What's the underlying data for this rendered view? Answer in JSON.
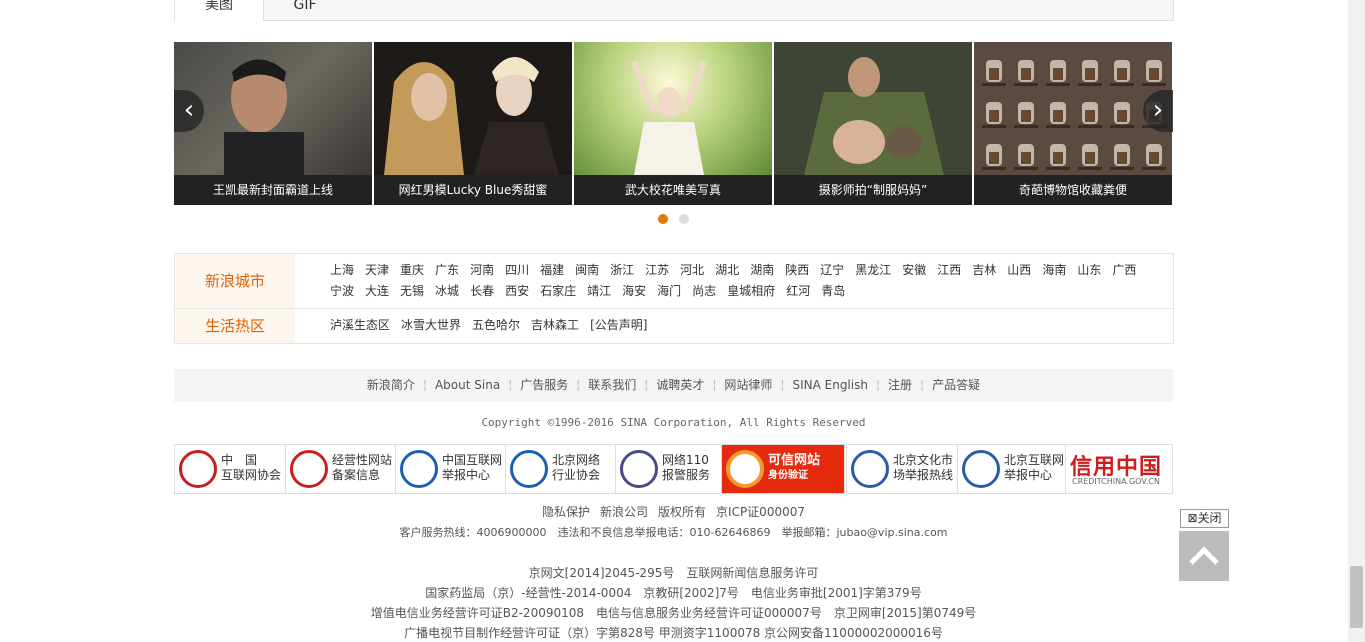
{
  "tabs": [
    "美图",
    "GIF"
  ],
  "slides": [
    {
      "caption": "王凯最新封面霸道上线"
    },
    {
      "caption": "网红男模Lucky Blue秀甜蜜"
    },
    {
      "caption": "武大校花唯美写真"
    },
    {
      "caption": "摄影师拍“制服妈妈”"
    },
    {
      "caption": "奇葩博物馆收藏粪便"
    }
  ],
  "colors": {
    "accent": "#e66000",
    "dot_active": "#e07b00",
    "dot_inactive": "#dddddd"
  },
  "city": {
    "label": "新浪城市",
    "links": [
      "上海",
      "天津",
      "重庆",
      "广东",
      "河南",
      "四川",
      "福建",
      "闽南",
      "浙江",
      "江苏",
      "河北",
      "湖北",
      "湖南",
      "陕西",
      "辽宁",
      "黑龙江",
      "安徽",
      "江西",
      "吉林",
      "山西",
      "海南",
      "山东",
      "广西",
      "宁波",
      "大连",
      "无锡",
      "冰城",
      "长春",
      "西安",
      "石家庄",
      "靖江",
      "海安",
      "海门",
      "尚志",
      "皇城相府",
      "红河",
      "青岛"
    ]
  },
  "life": {
    "label": "生活热区",
    "links": [
      "泸溪生态区",
      "冰雪大世界",
      "五色哈尔",
      "吉林森工",
      "[公告声明]"
    ]
  },
  "footer_nav": [
    "新浪简介",
    "About Sina",
    "广告服务",
    "联系我们",
    "诚聘英才",
    "网站律师",
    "SINA English",
    "注册",
    "产品答疑"
  ],
  "copyright": "Copyright ©1996-2016 SINA Corporation, All Rights Reserved",
  "badges": [
    {
      "line1": "中　国",
      "line2": "互联网协会",
      "icon": "isc-seal-icon"
    },
    {
      "line1": "经营性网站",
      "line2": "备案信息",
      "icon": "record-seal-icon"
    },
    {
      "line1": "中国互联网",
      "line2": "举报中心",
      "icon": "report-center-icon"
    },
    {
      "line1": "北京网络",
      "line2": "行业协会",
      "icon": "bnia-icon"
    },
    {
      "line1": "网络110",
      "line2": "报警服务",
      "icon": "police-shield-icon"
    },
    {
      "line1": "可信网站",
      "line2": "身份验证",
      "icon": "trusted-site-icon"
    },
    {
      "line1": "北京文化市",
      "line2": "场举报热线",
      "icon": "culture-market-icon"
    },
    {
      "line1": "北京互联网",
      "line2": "举报中心",
      "icon": "beijing-report-icon"
    },
    {
      "line1": "信用中国",
      "line2": "CREDITCHINA.GOV.CN",
      "icon": "credit-china-logo"
    }
  ],
  "legal_links": [
    "隐私保护",
    "新浪公司",
    "版权所有",
    "京ICP证000007"
  ],
  "hotline": "客户服务热线：4006900000　违法和不良信息举报电话：010-62646869　举报邮箱：jubao@vip.sina.com",
  "licenses": [
    "京网文[2014]2045-295号　互联网新闻信息服务许可",
    "国家药监局（京）-经营性-2014-0004　京教研[2002]7号　电信业务审批[2001]字第379号",
    "增值电信业务经营许可证B2-20090108　电信与信息服务业务经营许可证000007号　京卫网审[2015]第0749号",
    "广播电视节目制作经营许可证（京）字第828号 甲测资字1100078 京公网安备11000002000016号"
  ],
  "close_label": "关闭"
}
